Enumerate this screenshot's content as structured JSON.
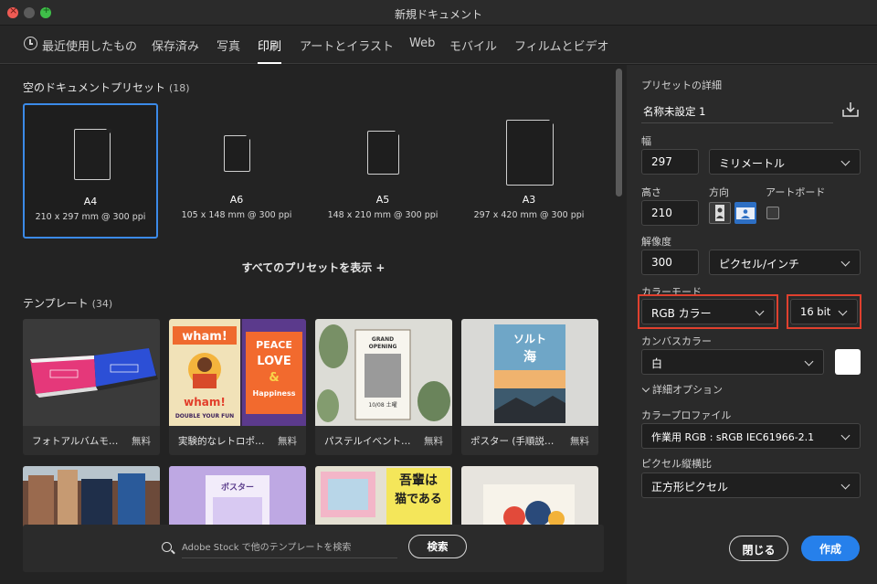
{
  "window": {
    "title": "新規ドキュメント"
  },
  "tabs": [
    {
      "label": "最近使用したもの"
    },
    {
      "label": "保存済み"
    },
    {
      "label": "写真"
    },
    {
      "label": "印刷",
      "active": true
    },
    {
      "label": "アートとイラスト"
    },
    {
      "label": "Web"
    },
    {
      "label": "モバイル"
    },
    {
      "label": "フィルムとビデオ"
    }
  ],
  "blank_presets": {
    "title": "空のドキュメントプリセット",
    "count": "(18)",
    "items": [
      {
        "name": "A4",
        "size": "210 x 297 mm @ 300 ppi",
        "selected": true
      },
      {
        "name": "A6",
        "size": "105 x 148 mm @ 300 ppi"
      },
      {
        "name": "A5",
        "size": "148 x 210 mm @ 300 ppi"
      },
      {
        "name": "A3",
        "size": "297 x 420 mm @ 300 ppi"
      }
    ],
    "show_all": "すべてのプリセットを表示 +"
  },
  "templates": {
    "title": "テンプレート",
    "count": "(34)",
    "items": [
      {
        "name": "フォトアルバムモ…",
        "price": "無料"
      },
      {
        "name": "実験的なレトロポ…",
        "price": "無料",
        "art_text": [
          "wham!",
          "PEACE",
          "LOVE",
          "&",
          "Happiness",
          "wham!",
          "DOUBLE YOUR FUN"
        ]
      },
      {
        "name": "パステルイベント…",
        "price": "無料",
        "art_text": [
          "GRAND",
          "OPENING",
          "10/08 土曜"
        ]
      },
      {
        "name": "ポスター (手順説…",
        "price": "無料",
        "art_text": [
          "ソルト",
          "海"
        ]
      }
    ],
    "row2_art_text": [
      "ポスター",
      "吾輩は",
      "猫である"
    ]
  },
  "search": {
    "placeholder": "Adobe Stock で他のテンプレートを検索",
    "button": "検索"
  },
  "details": {
    "title": "プリセットの詳細",
    "doc_name": "名称未設定 1",
    "width_label": "幅",
    "width_value": "297",
    "width_unit": "ミリメートル",
    "height_label": "高さ",
    "height_value": "210",
    "orientation_label": "方向",
    "artboard_label": "アートボード",
    "resolution_label": "解像度",
    "resolution_value": "300",
    "resolution_unit": "ピクセル/インチ",
    "color_mode_label": "カラーモード",
    "color_mode": "RGB カラー",
    "bit_depth": "16 bit",
    "canvas_color_label": "カンバスカラー",
    "canvas_color": "白",
    "advanced_label": "詳細オプション",
    "color_profile_label": "カラープロファイル",
    "color_profile": "作業用 RGB : sRGB IEC61966-2.1",
    "pixel_aspect_label": "ピクセル縦横比",
    "pixel_aspect": "正方形ピクセル",
    "close_button": "閉じる",
    "create_button": "作成"
  },
  "colors": {
    "accent": "#2680eb",
    "highlight": "#e0402e",
    "selection": "#3b8ae8"
  }
}
